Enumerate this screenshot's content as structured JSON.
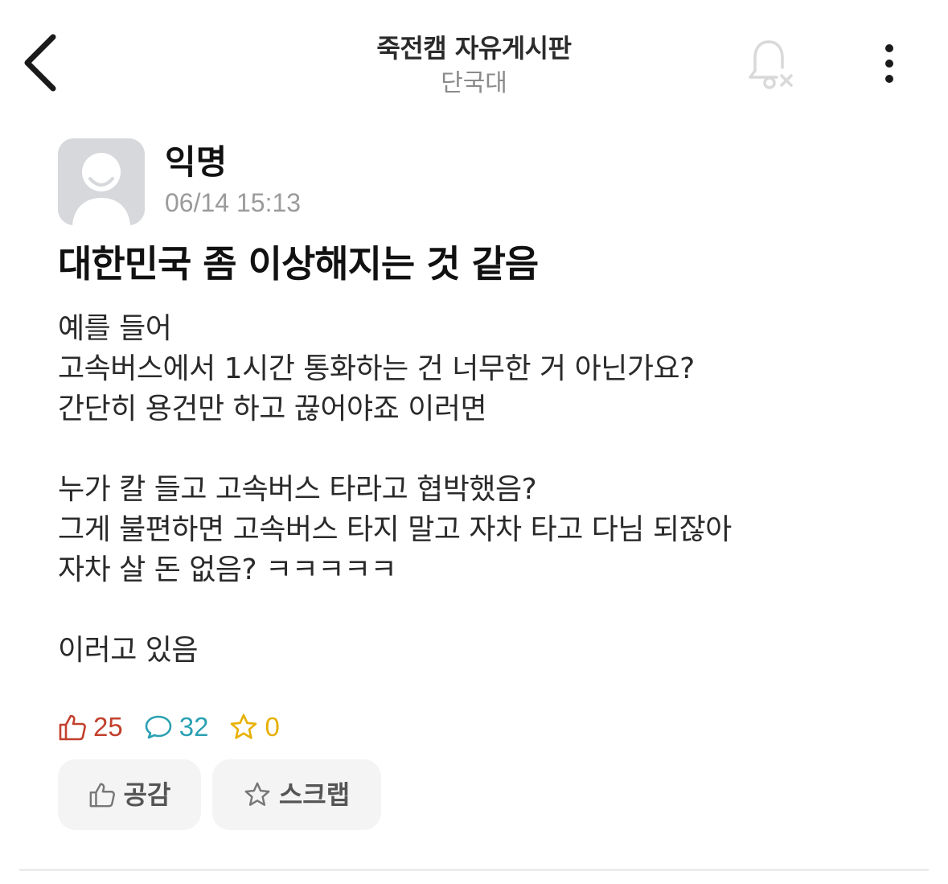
{
  "header": {
    "board_title": "죽전캠 자유게시판",
    "school": "단국대",
    "back_icon": "chevron-left-icon",
    "notification_icon": "bell-off-icon",
    "more_icon": "vertical-dots-icon"
  },
  "post": {
    "author": "익명",
    "timestamp": "06/14 15:13",
    "title": "대한민국 좀 이상해지는 것 같음",
    "body_lines": [
      "예를 들어",
      "고속버스에서 1시간 통화하는 건 너무한 거 아닌가요?",
      "간단히 용건만 하고 끊어야죠 이러면",
      "",
      "누가 칼 들고 고속버스 타라고 협박했음?",
      "그게 불편하면 고속버스 타지 말고 자차 타고 다님 되잖아",
      "자차 살 돈 없음? ㅋㅋㅋㅋㅋ",
      "",
      "이러고 있음"
    ]
  },
  "stats": {
    "likes": "25",
    "comments": "32",
    "scraps": "0"
  },
  "actions": {
    "empathy_label": "공감",
    "scrap_label": "스크랩"
  },
  "colors": {
    "like": "#c2402d",
    "comment": "#2ba1b3",
    "scrap": "#e8b000",
    "button_bg": "#f4f4f4"
  }
}
